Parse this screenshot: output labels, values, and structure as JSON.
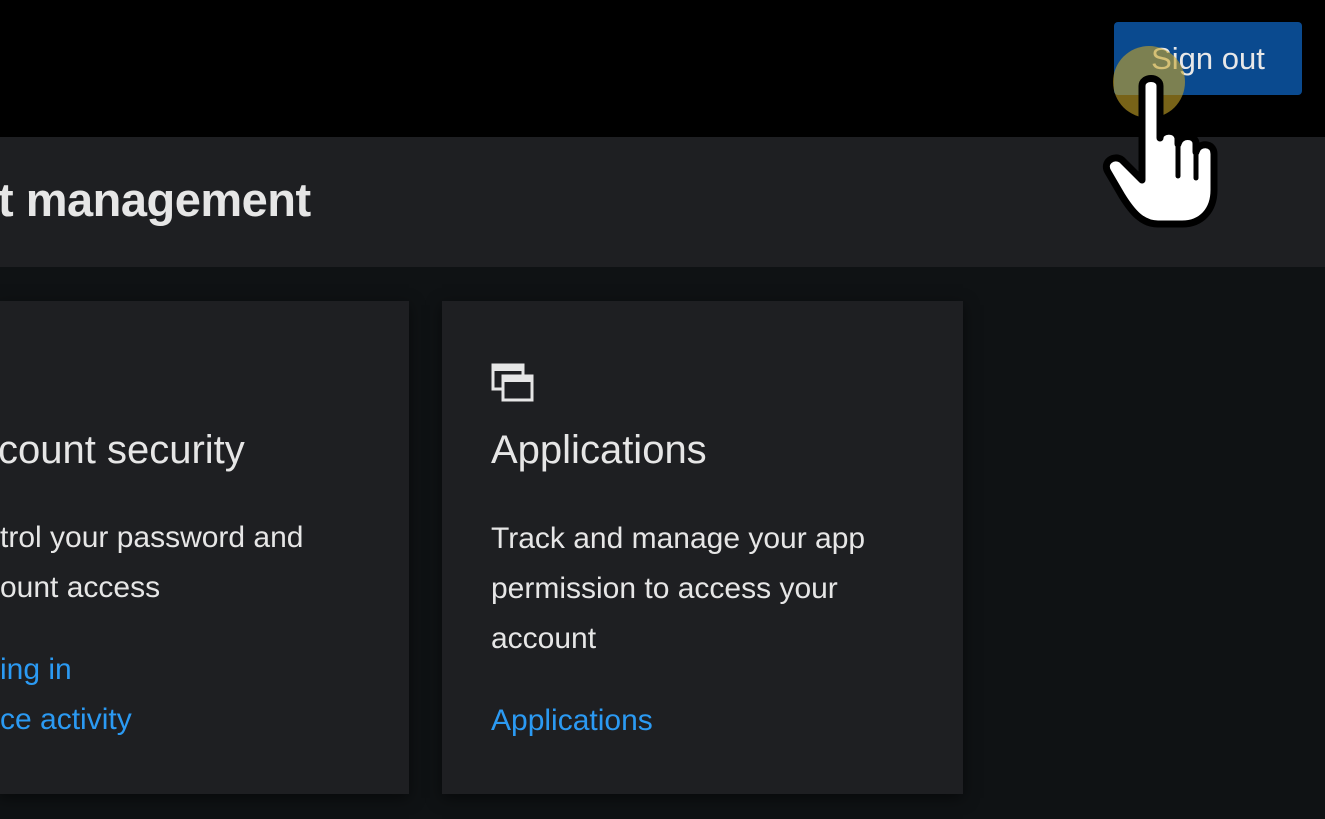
{
  "header": {
    "signout_label": "Sign out",
    "accent_color": "#0a4a8f"
  },
  "page": {
    "title": "t management"
  },
  "cards": [
    {
      "title": "count security",
      "desc_lines": [
        "trol your password and",
        "ount access"
      ],
      "links": [
        "ing in",
        "ce activity"
      ]
    },
    {
      "icon": "applications-icon",
      "title": "Applications",
      "desc_lines": [
        "Track and manage your app",
        "permission to access your",
        "account"
      ],
      "links": [
        "Applications"
      ]
    }
  ],
  "colors": {
    "link": "#2b9af3",
    "card_bg": "#1e1f22",
    "header_bg": "#000000"
  },
  "cursor": {
    "icon": "hand-pointer-icon"
  }
}
